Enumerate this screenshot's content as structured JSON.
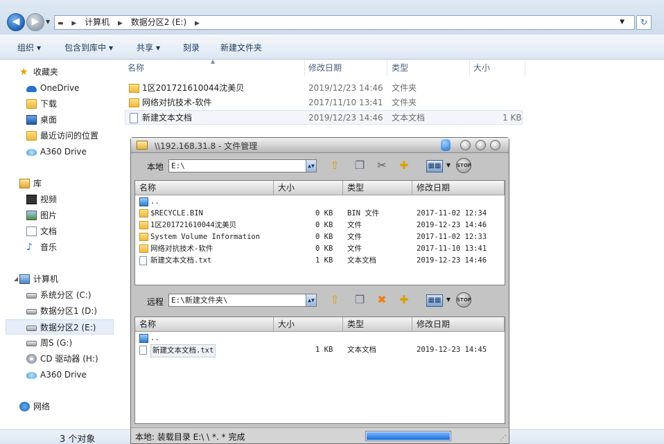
{
  "explorer": {
    "breadcrumb": [
      "计算机",
      "数据分区2 (E:)"
    ],
    "toolbar": [
      "组织",
      "包含到库中",
      "共享",
      "刻录",
      "新建文件夹"
    ],
    "nav": {
      "favorites_label": "收藏夹",
      "favorites": [
        "OneDrive",
        "下载",
        "桌面",
        "最近访问的位置",
        "A360 Drive"
      ],
      "libraries_label": "库",
      "libraries": [
        "视频",
        "图片",
        "文档",
        "音乐"
      ],
      "computer_label": "计算机",
      "drives": [
        "系统分区 (C:)",
        "数据分区1 (D:)",
        "数据分区2 (E:)",
        "周S (G:)",
        "CD 驱动器 (H:)",
        "A360 Drive"
      ],
      "network_label": "网络"
    },
    "columns": [
      "名称",
      "修改日期",
      "类型",
      "大小"
    ],
    "files": [
      {
        "name": "1区201721610044沈美贝",
        "date": "2019/12/23 14:46",
        "type": "文件夹",
        "size": "",
        "icon": "folder"
      },
      {
        "name": "网络对抗技术-软件",
        "date": "2017/11/10 13:41",
        "type": "文件夹",
        "size": "",
        "icon": "folder"
      },
      {
        "name": "新建文本文档",
        "date": "2019/12/23 14:46",
        "type": "文本文档",
        "size": "1 KB",
        "icon": "text-file"
      }
    ],
    "status": "3 个对象"
  },
  "dialog": {
    "title": "\\\\192.168.31.8 - 文件管理",
    "local": {
      "label": "本地",
      "path": "E:\\",
      "columns": [
        "名称",
        "大小",
        "类型",
        "修改日期"
      ],
      "rows": [
        {
          "name": "..",
          "size": "",
          "type": "",
          "date": "",
          "icon": "parent"
        },
        {
          "name": "$RECYCLE.BIN",
          "size": "0 KB",
          "type": "BIN 文件",
          "date": "2017-11-02 12:34",
          "icon": "folder"
        },
        {
          "name": "1区201721610044沈美贝",
          "size": "0 KB",
          "type": "文件",
          "date": "2019-12-23 14:46",
          "icon": "folder"
        },
        {
          "name": "System Volume Information",
          "size": "0 KB",
          "type": "文件",
          "date": "2017-11-02 12:33",
          "icon": "folder"
        },
        {
          "name": "网络对抗技术-软件",
          "size": "0 KB",
          "type": "文件",
          "date": "2017-11-10 13:41",
          "icon": "folder"
        },
        {
          "name": "新建文本文档.txt",
          "size": "1 KB",
          "type": "文本文档",
          "date": "2019-12-23 14:46",
          "icon": "text-file"
        }
      ]
    },
    "remote": {
      "label": "远程",
      "path": "E:\\新建文件夹\\",
      "columns": [
        "名称",
        "大小",
        "类型",
        "修改日期"
      ],
      "rows": [
        {
          "name": "..",
          "size": "",
          "type": "",
          "date": "",
          "icon": "parent"
        },
        {
          "name": "新建文本文档.txt",
          "size": "1 KB",
          "type": "文本文档",
          "date": "2019-12-23 14:45",
          "icon": "text-file"
        }
      ]
    },
    "status": "本地: 装载目录 E:\\ \\ *. * 完成",
    "progress": 1.0,
    "stop_label": "STOP"
  }
}
